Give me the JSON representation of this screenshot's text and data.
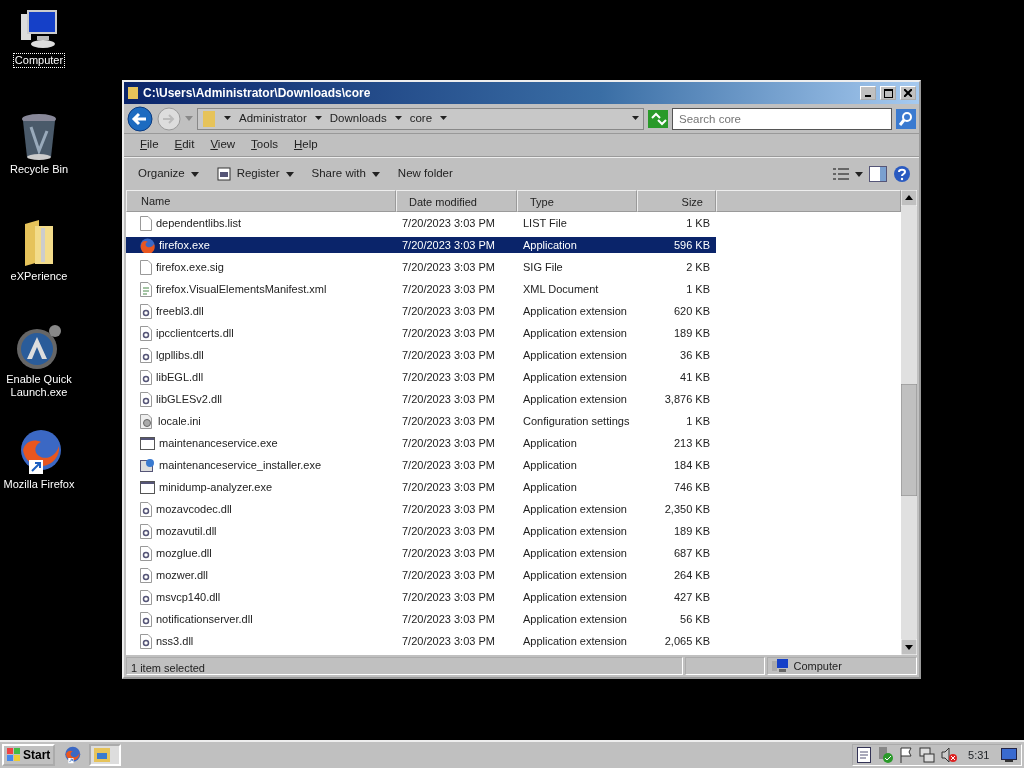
{
  "desktop_icons": [
    {
      "label": "Computer",
      "kind": "computer",
      "selected": true
    },
    {
      "label": "Recycle Bin",
      "kind": "bin",
      "selected": false
    },
    {
      "label": "eXPerience",
      "kind": "folder",
      "selected": false
    },
    {
      "label": "Enable Quick Launch.exe",
      "kind": "launch",
      "selected": false
    },
    {
      "label": "Mozilla Firefox",
      "kind": "firefox",
      "selected": false
    }
  ],
  "window": {
    "title": "C:\\Users\\Administrator\\Downloads\\core",
    "breadcrumb": [
      "Administrator",
      "Downloads",
      "core"
    ],
    "search": {
      "placeholder": "Search core"
    },
    "menu": [
      "File",
      "Edit",
      "View",
      "Tools",
      "Help"
    ],
    "toolbar": [
      {
        "label": "Organize",
        "kind": "dropdown"
      },
      {
        "label": "Register",
        "kind": "iconmenu"
      },
      {
        "label": "Share with",
        "kind": "dropdown"
      },
      {
        "label": "New folder",
        "kind": "plain"
      }
    ],
    "columns": [
      "Name",
      "Date modified",
      "Type",
      "Size"
    ],
    "rows": [
      {
        "name": "dependentlibs.list",
        "date": "7/20/2023 3:03 PM",
        "type": "LIST File",
        "size": "1 KB",
        "kind": "blank",
        "selected": false
      },
      {
        "name": "firefox.exe",
        "date": "7/20/2023 3:03 PM",
        "type": "Application",
        "size": "596 KB",
        "kind": "firefox",
        "selected": true
      },
      {
        "name": "firefox.exe.sig",
        "date": "7/20/2023 3:03 PM",
        "type": "SIG File",
        "size": "2 KB",
        "kind": "blank",
        "selected": false
      },
      {
        "name": "firefox.VisualElementsManifest.xml",
        "date": "7/20/2023 3:03 PM",
        "type": "XML Document",
        "size": "1 KB",
        "kind": "xml",
        "selected": false
      },
      {
        "name": "freebl3.dll",
        "date": "7/20/2023 3:03 PM",
        "type": "Application extension",
        "size": "620 KB",
        "kind": "dll",
        "selected": false
      },
      {
        "name": "ipcclientcerts.dll",
        "date": "7/20/2023 3:03 PM",
        "type": "Application extension",
        "size": "189 KB",
        "kind": "dll",
        "selected": false
      },
      {
        "name": "lgpllibs.dll",
        "date": "7/20/2023 3:03 PM",
        "type": "Application extension",
        "size": "36 KB",
        "kind": "dll",
        "selected": false
      },
      {
        "name": "libEGL.dll",
        "date": "7/20/2023 3:03 PM",
        "type": "Application extension",
        "size": "41 KB",
        "kind": "dll",
        "selected": false
      },
      {
        "name": "libGLESv2.dll",
        "date": "7/20/2023 3:03 PM",
        "type": "Application extension",
        "size": "3,876 KB",
        "kind": "dll",
        "selected": false
      },
      {
        "name": "locale.ini",
        "date": "7/20/2023 3:03 PM",
        "type": "Configuration settings",
        "size": "1 KB",
        "kind": "ini",
        "selected": false
      },
      {
        "name": "maintenanceservice.exe",
        "date": "7/20/2023 3:03 PM",
        "type": "Application",
        "size": "213 KB",
        "kind": "app",
        "selected": false
      },
      {
        "name": "maintenanceservice_installer.exe",
        "date": "7/20/2023 3:03 PM",
        "type": "Application",
        "size": "184 KB",
        "kind": "installer",
        "selected": false
      },
      {
        "name": "minidump-analyzer.exe",
        "date": "7/20/2023 3:03 PM",
        "type": "Application",
        "size": "746 KB",
        "kind": "app",
        "selected": false
      },
      {
        "name": "mozavcodec.dll",
        "date": "7/20/2023 3:03 PM",
        "type": "Application extension",
        "size": "2,350 KB",
        "kind": "dll",
        "selected": false
      },
      {
        "name": "mozavutil.dll",
        "date": "7/20/2023 3:03 PM",
        "type": "Application extension",
        "size": "189 KB",
        "kind": "dll",
        "selected": false
      },
      {
        "name": "mozglue.dll",
        "date": "7/20/2023 3:03 PM",
        "type": "Application extension",
        "size": "687 KB",
        "kind": "dll",
        "selected": false
      },
      {
        "name": "mozwer.dll",
        "date": "7/20/2023 3:03 PM",
        "type": "Application extension",
        "size": "264 KB",
        "kind": "dll",
        "selected": false
      },
      {
        "name": "msvcp140.dll",
        "date": "7/20/2023 3:03 PM",
        "type": "Application extension",
        "size": "427 KB",
        "kind": "dll",
        "selected": false
      },
      {
        "name": "notificationserver.dll",
        "date": "7/20/2023 3:03 PM",
        "type": "Application extension",
        "size": "56 KB",
        "kind": "dll",
        "selected": false
      },
      {
        "name": "nss3.dll",
        "date": "7/20/2023 3:03 PM",
        "type": "Application extension",
        "size": "2,065 KB",
        "kind": "dll",
        "selected": false
      }
    ],
    "status_bar": {
      "text": "1 item selected",
      "zone": "Computer"
    }
  },
  "taskbar": {
    "start": "Start",
    "clock": "5:31"
  }
}
